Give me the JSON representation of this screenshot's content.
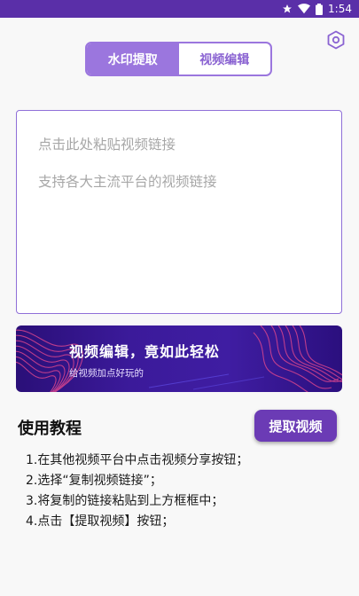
{
  "status_bar": {
    "time": "1:54",
    "icons": [
      "star-icon",
      "wifi-icon",
      "battery-icon"
    ]
  },
  "header": {
    "settings_icon": "hexagon-settings-icon"
  },
  "tabs": [
    {
      "label": "水印提取",
      "active": true
    },
    {
      "label": "视频编辑",
      "active": false
    }
  ],
  "link_input": {
    "placeholder_line1": "点击此处粘贴视频链接",
    "placeholder_line2": "支持各大主流平台的视频链接"
  },
  "banner": {
    "title": "视频编辑，竟如此轻松",
    "subtitle": "给视频加点好玩的"
  },
  "tutorial": {
    "title": "使用教程",
    "extract_button": "提取视频",
    "steps": [
      "1.在其他视频平台中点击视频分享按钮；",
      "2.选择“复制视频链接”；",
      "3.将复制的链接粘贴到上方框框中；",
      "4.点击【提取视频】按钮；"
    ]
  },
  "colors": {
    "accent": "#9b76de",
    "button": "#6b3bb5",
    "status_bar": "#5a2fa8",
    "banner_dark": "#2a0f78"
  }
}
